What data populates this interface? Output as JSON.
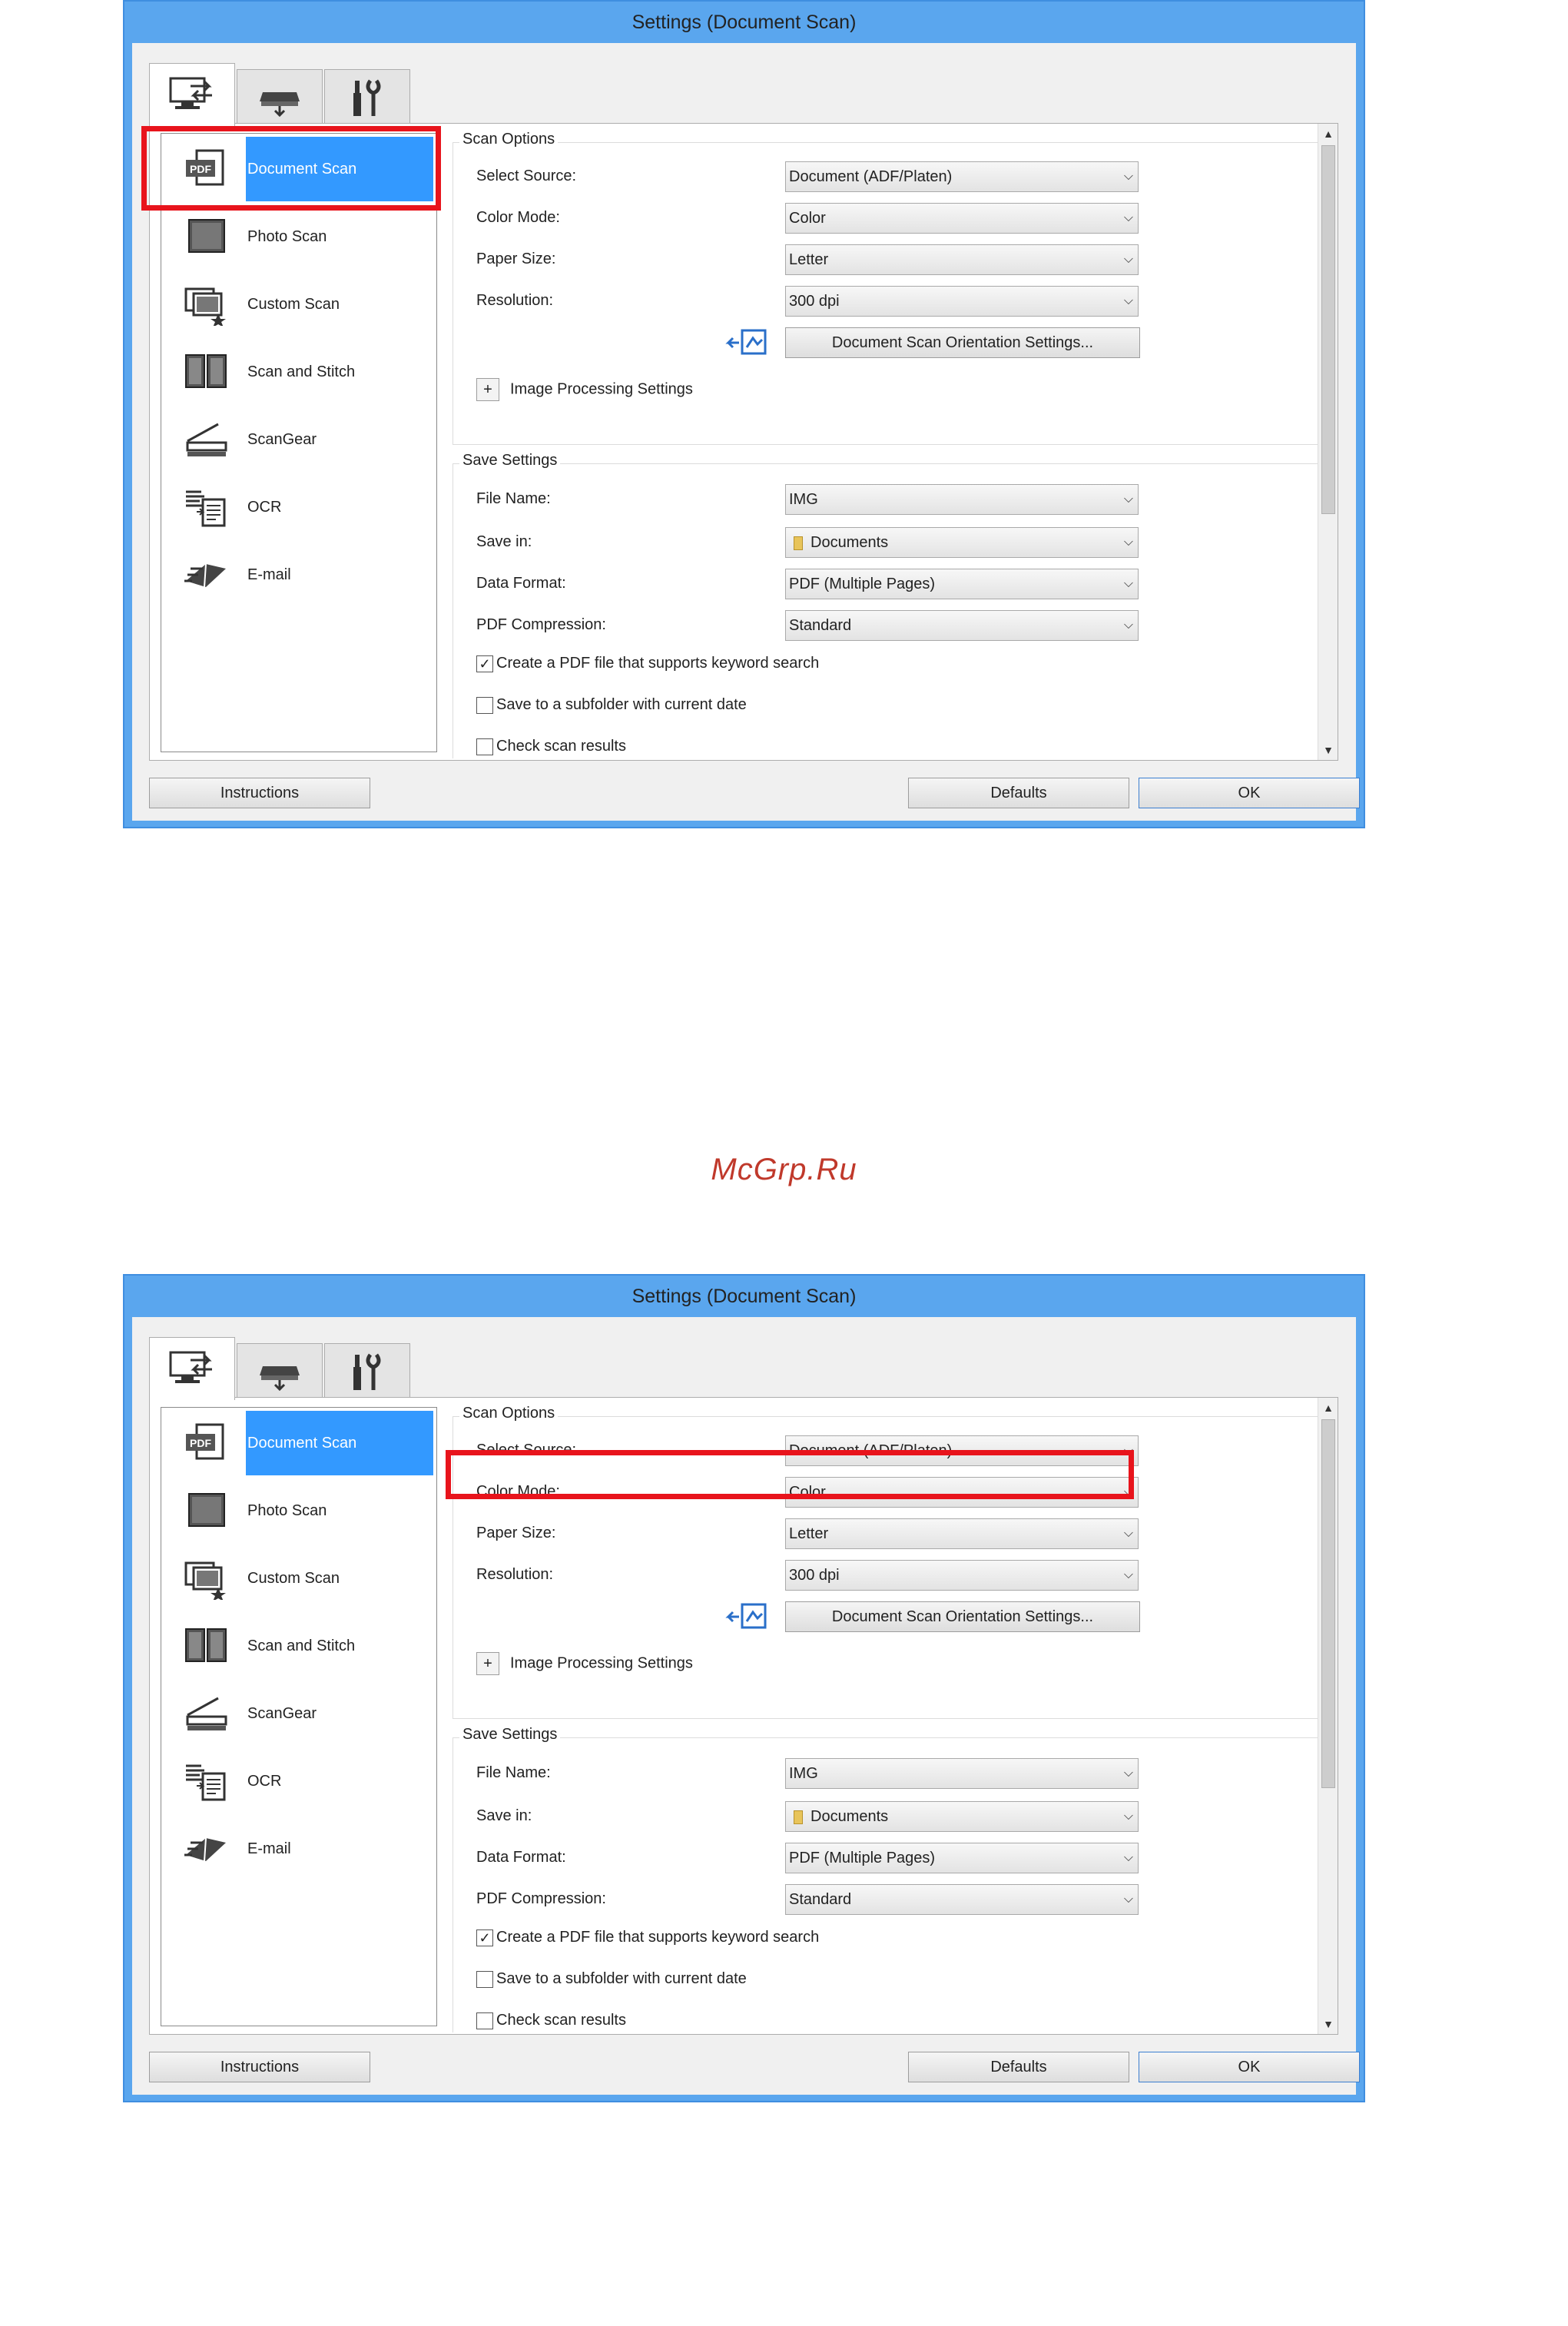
{
  "dialog": {
    "title": "Settings (Document Scan)",
    "tabs": [
      {
        "icon": "scan-from-computer-icon"
      },
      {
        "icon": "scan-from-operation-panel-icon"
      },
      {
        "icon": "general-settings-icon"
      }
    ],
    "sidebar": {
      "items": [
        {
          "label": "Document Scan",
          "icon": "pdf-document-icon",
          "selected": true
        },
        {
          "label": "Photo Scan",
          "icon": "photo-icon"
        },
        {
          "label": "Custom Scan",
          "icon": "custom-scan-icon"
        },
        {
          "label": "Scan and Stitch",
          "icon": "stitch-icon"
        },
        {
          "label": "ScanGear",
          "icon": "scanner-icon"
        },
        {
          "label": "OCR",
          "icon": "ocr-icon"
        },
        {
          "label": "E-mail",
          "icon": "email-icon"
        }
      ]
    },
    "scan_options": {
      "title": "Scan Options",
      "select_source": {
        "label": "Select Source:",
        "value": "Document (ADF/Platen)"
      },
      "color_mode": {
        "label": "Color Mode:",
        "value": "Color"
      },
      "paper_size": {
        "label": "Paper Size:",
        "value": "Letter"
      },
      "resolution": {
        "label": "Resolution:",
        "value": "300 dpi"
      },
      "orientation_button": "Document Scan Orientation Settings...",
      "image_processing": "Image Processing Settings"
    },
    "save_settings": {
      "title": "Save Settings",
      "file_name": {
        "label": "File Name:",
        "value": "IMG"
      },
      "save_in": {
        "label": "Save in:",
        "value": "Documents"
      },
      "data_format": {
        "label": "Data Format:",
        "value": "PDF (Multiple Pages)"
      },
      "pdf_compression": {
        "label": "PDF Compression:",
        "value": "Standard"
      },
      "keyword_search": {
        "label": "Create a PDF file that supports keyword search",
        "checked": true
      },
      "subfolder": {
        "label": "Save to a subfolder with current date",
        "checked": false
      },
      "check_results": {
        "label": "Check scan results",
        "checked": false
      }
    },
    "buttons": {
      "instructions": "Instructions",
      "defaults": "Defaults",
      "ok": "OK"
    }
  },
  "watermark": "McGrp.Ru",
  "colors": {
    "frame": "#5aa6ee",
    "selection": "#3399ff",
    "highlight": "#e8141c"
  }
}
